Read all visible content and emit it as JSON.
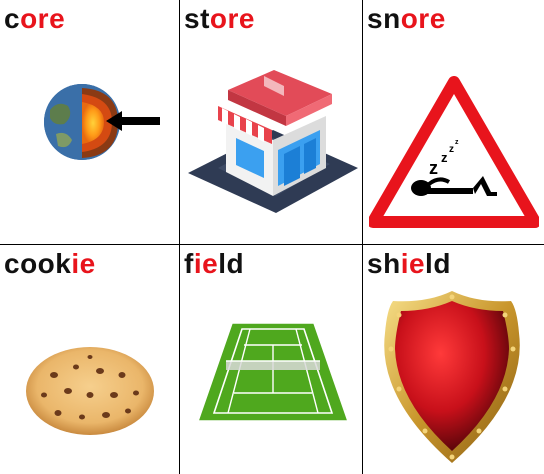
{
  "colors": {
    "highlight": "#e8141c",
    "text": "#111111",
    "grid": "#000000"
  },
  "cards": [
    {
      "name": "core",
      "parts": [
        {
          "t": "c",
          "hl": false
        },
        {
          "t": "ore",
          "hl": true
        }
      ],
      "icon": "earth-core-icon"
    },
    {
      "name": "store",
      "parts": [
        {
          "t": "st",
          "hl": false
        },
        {
          "t": "ore",
          "hl": true
        }
      ],
      "icon": "shop-icon"
    },
    {
      "name": "snore",
      "parts": [
        {
          "t": "sn",
          "hl": false
        },
        {
          "t": "ore",
          "hl": true
        }
      ],
      "icon": "snoring-sign-icon"
    },
    {
      "name": "cookie",
      "parts": [
        {
          "t": "cook",
          "hl": false
        },
        {
          "t": "ie",
          "hl": true
        }
      ],
      "icon": "cookie-icon"
    },
    {
      "name": "field",
      "parts": [
        {
          "t": "f",
          "hl": false
        },
        {
          "t": "ie",
          "hl": true
        },
        {
          "t": "ld",
          "hl": false
        }
      ],
      "icon": "tennis-field-icon"
    },
    {
      "name": "shield",
      "parts": [
        {
          "t": "sh",
          "hl": false
        },
        {
          "t": "ie",
          "hl": true
        },
        {
          "t": "ld",
          "hl": false
        }
      ],
      "icon": "shield-icon"
    }
  ]
}
